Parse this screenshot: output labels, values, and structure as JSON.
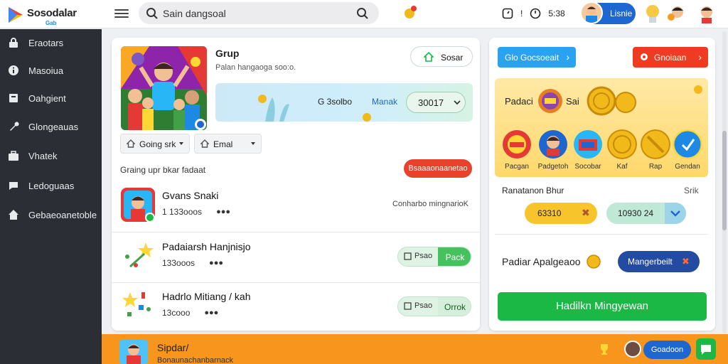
{
  "brand": {
    "name": "Sosodalar",
    "sub": "Gab",
    "colors": {
      "accent": "#1e66d0",
      "sidebar": "#2b2f35",
      "green": "#1bb846",
      "red": "#ee3b22",
      "orange": "#f7951c"
    }
  },
  "search": {
    "value": "Sain dangsoal"
  },
  "topbar": {
    "time1": "5:38",
    "user": "Lisnie",
    "icons": [
      "coin-icon",
      "timer-icon",
      "clock-icon"
    ]
  },
  "sidebar": {
    "items": [
      {
        "label": "Eraotars",
        "icon": "lock-icon"
      },
      {
        "label": "Masoiua",
        "icon": "info-icon"
      },
      {
        "label": "Oahgient",
        "icon": "square-icon"
      },
      {
        "label": "Glongeauas",
        "icon": "wrench-icon"
      },
      {
        "label": "Vhatek",
        "icon": "briefcase-icon"
      },
      {
        "label": "Ledoguaas",
        "icon": "chat-icon"
      },
      {
        "label": "Gebaeoanetoble",
        "icon": "home-icon"
      }
    ]
  },
  "group": {
    "title": "Grup",
    "subtitle": "Palan hangaoga soo:o.",
    "share_label": "Sosar",
    "promo": {
      "label1": "G 3solbo",
      "label2": "Manak",
      "code": "30017"
    },
    "dropdown1": "Going srk",
    "dropdown2": "Emal",
    "section_title": "Graing upr bkar fadaat",
    "section_pill": "Bsaaaonaanetao"
  },
  "rows": [
    {
      "name": "Gvans Snaki",
      "meta": "1  133ooos",
      "right": "Conharbo mingnarioK"
    },
    {
      "name": "Padaiarsh Hanjnisjo",
      "meta": "133ooos",
      "pill_a": "Psao",
      "pill_b": "Pack"
    },
    {
      "name": "Hadrlo Mitiang / kah",
      "meta": "13cooo",
      "pill_a": "Psao",
      "pill_b": "Orrok"
    }
  ],
  "right": {
    "btn_blue": "Glo Gocsoeait",
    "btn_red": "Gnoiaan",
    "gold_t1": "Padaci",
    "gold_t2": "Sai",
    "medals": [
      "Pacgan",
      "Padgetoh",
      "Socobar",
      "Kaf",
      "Rap",
      "Gendan"
    ],
    "resv_label": "Ranatanon Bhur",
    "resv_right": "Srik",
    "yellow_val": "63310",
    "mint_val": "10930 24",
    "apl_label": "Padiar Apalgeaoo",
    "navy_btn": "Mangerbeilt",
    "green_btn": "Hadilkn Mingyewan"
  },
  "bottom": {
    "title": "Sipdar/",
    "subtitle": "Bonaunachanbarnack",
    "pill": "Goadoon"
  }
}
